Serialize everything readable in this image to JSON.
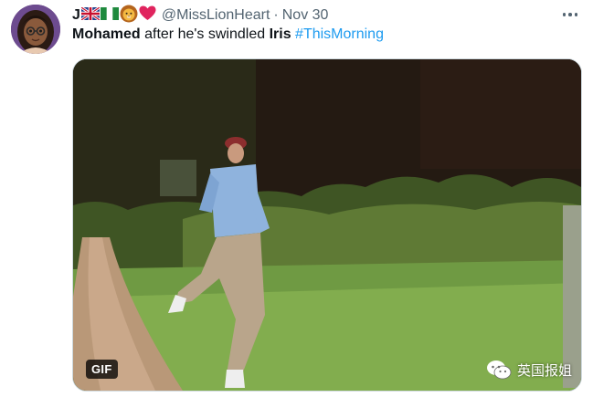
{
  "tweet": {
    "author_name": "J",
    "author_emojis": [
      "uk-flag",
      "nigeria-flag",
      "lion-face",
      "red-heart"
    ],
    "handle": "@MissLionHeart",
    "separator": "·",
    "date": "Nov 30",
    "body": {
      "part1": "Mohamed",
      "part2": " after he's swindled ",
      "part3": "Iris",
      "part4": " ",
      "hashtag": "#ThisMorning"
    },
    "media": {
      "badge": "GIF",
      "watermark_text": "英国报姐"
    }
  },
  "colors": {
    "text_primary": "#0f1419",
    "text_secondary": "#536471",
    "hashtag": "#1d9bf0",
    "border": "#cfd9de"
  }
}
